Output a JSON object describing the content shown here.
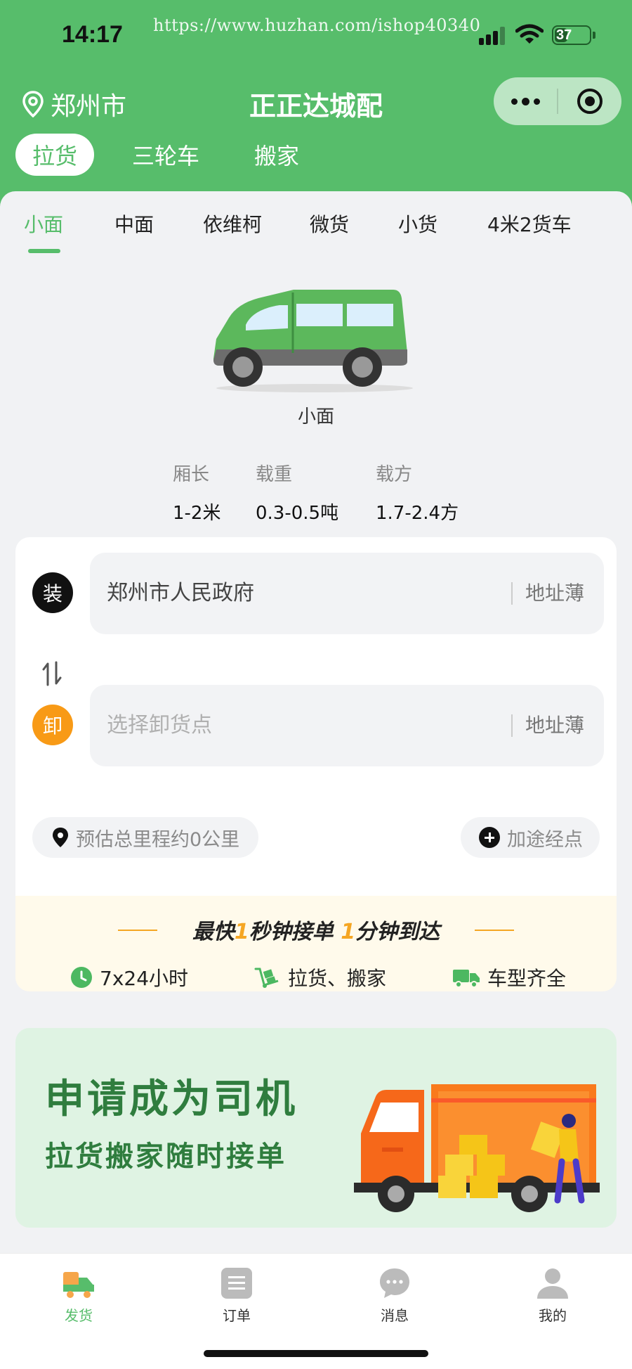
{
  "status_bar": {
    "time": "14:17",
    "watermark": "https://www.huzhan.com/ishop40340",
    "battery": "37",
    "battery_level": 0.37
  },
  "header": {
    "city": "郑州市",
    "title": "正正达城配"
  },
  "service_tabs": [
    {
      "label": "拉货",
      "active": true
    },
    {
      "label": "三轮车",
      "active": false
    },
    {
      "label": "搬家",
      "active": false
    }
  ],
  "vehicle_tabs": [
    {
      "label": "小面",
      "active": true
    },
    {
      "label": "中面",
      "active": false
    },
    {
      "label": "依维柯",
      "active": false
    },
    {
      "label": "微货",
      "active": false
    },
    {
      "label": "小货",
      "active": false
    },
    {
      "label": "4米2货车",
      "active": false
    }
  ],
  "vehicle": {
    "name": "小面",
    "specs": [
      {
        "label": "厢长",
        "value": "1-2米"
      },
      {
        "label": "载重",
        "value": "0.3-0.5吨"
      },
      {
        "label": "载方",
        "value": "1.7-2.4方"
      }
    ]
  },
  "address": {
    "load_badge": "装",
    "load_value": "郑州市人民政府",
    "unload_badge": "卸",
    "unload_placeholder": "选择卸货点",
    "book_label": "地址薄",
    "distance_text": "预估总里程约0公里",
    "waypoint_label": "加途经点"
  },
  "promo": {
    "headline_a": "最快",
    "num_a": "1",
    "headline_b": "秒钟接单",
    "num_b": "1",
    "headline_c": "分钟到达",
    "features": [
      {
        "icon": "clock-icon",
        "label": "7x24小时"
      },
      {
        "icon": "hand-truck-icon",
        "label": "拉货、搬家"
      },
      {
        "icon": "truck-icon",
        "label": "车型齐全"
      }
    ]
  },
  "banner": {
    "title": "申请成为司机",
    "subtitle": "拉货搬家随时接单"
  },
  "tabbar": [
    {
      "label": "发货",
      "icon": "delivery-truck-icon",
      "active": true
    },
    {
      "label": "订单",
      "icon": "order-list-icon",
      "active": false
    },
    {
      "label": "消息",
      "icon": "chat-bubble-icon",
      "active": false
    },
    {
      "label": "我的",
      "icon": "user-icon",
      "active": false
    }
  ],
  "colors": {
    "brand_green": "#57bd6b",
    "accent_orange": "#f89a16",
    "banner_bg": "#dff3e3",
    "promo_bg": "#fffaeb"
  }
}
